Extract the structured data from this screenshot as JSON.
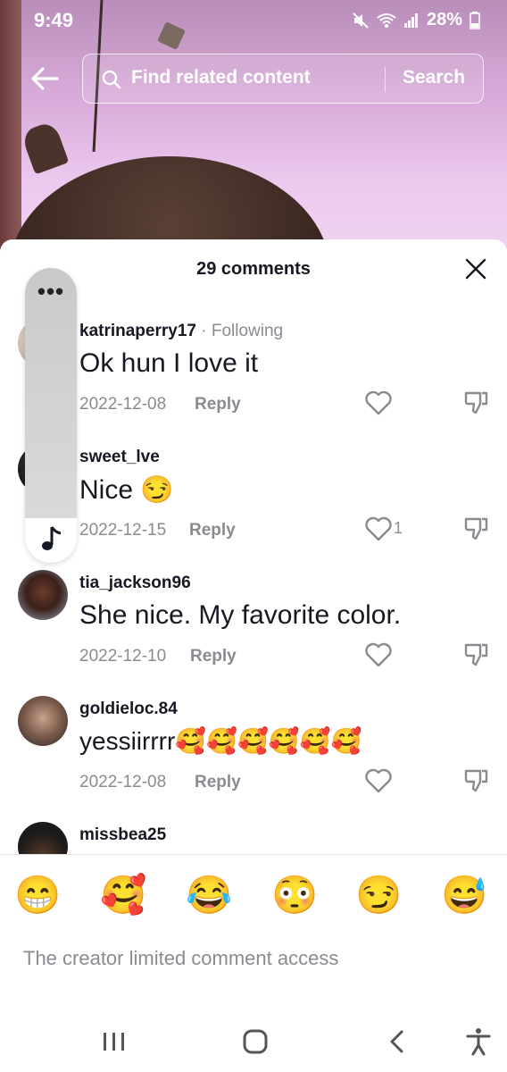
{
  "status_bar": {
    "time": "9:49",
    "battery": "28%"
  },
  "search": {
    "placeholder": "Find related content",
    "button_label": "Search"
  },
  "comments_panel": {
    "count_label": "29 comments"
  },
  "comments": [
    {
      "username": "katrinaperry17",
      "following_label": "Following",
      "text": "Ok hun I love it",
      "date": "2022-12-08",
      "reply_label": "Reply",
      "likes": ""
    },
    {
      "username": "sweet_lve",
      "following_label": "",
      "text": "Nice 😏",
      "date": "2022-12-15",
      "reply_label": "Reply",
      "likes": "1"
    },
    {
      "username": "tia_jackson96",
      "following_label": "",
      "text": "She nice. My favorite color.",
      "date": "2022-12-10",
      "reply_label": "Reply",
      "likes": ""
    },
    {
      "username": "goldieloc.84",
      "following_label": "",
      "text": "yessiirrrr🥰🥰🥰🥰🥰🥰",
      "date": "2022-12-08",
      "reply_label": "Reply",
      "likes": ""
    },
    {
      "username": "missbea25"
    }
  ],
  "side_bar": {
    "more_label": "•••"
  },
  "emoji_bar": [
    "😁",
    "🥰",
    "😂",
    "😳",
    "😏",
    "😅"
  ],
  "footer": {
    "notice": "The creator limited comment access"
  },
  "colors": {
    "text_primary": "#161823",
    "text_secondary": "#8a8b91"
  }
}
